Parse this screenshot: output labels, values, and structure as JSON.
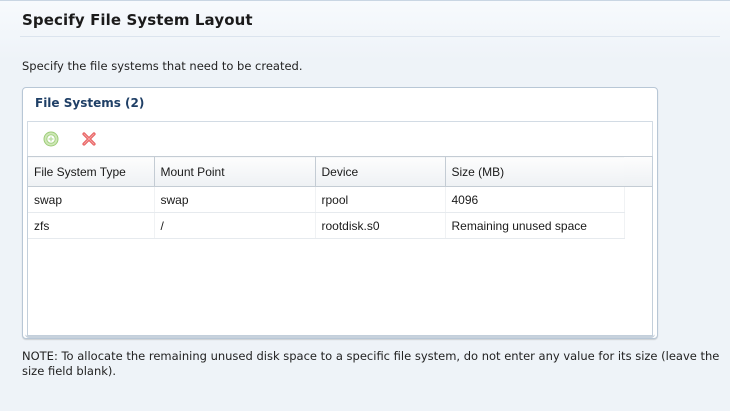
{
  "page": {
    "title": "Specify File System Layout",
    "description": "Specify the file systems that need to be created.",
    "note": "NOTE: To allocate the remaining unused disk space to a specific file system, do not enter any value for its size (leave the size field blank)."
  },
  "panel": {
    "header": "File Systems (2)"
  },
  "toolbar": {
    "add_icon": "add-circle-icon",
    "delete_icon": "delete-x-icon",
    "colors": {
      "add": "#8bc34a",
      "delete": "#e84a4a"
    }
  },
  "table": {
    "columns": [
      "File System Type",
      "Mount Point",
      "Device",
      "Size (MB)"
    ],
    "rows": [
      [
        "swap",
        "swap",
        "rpool",
        "4096"
      ],
      [
        "zfs",
        "/",
        "rootdisk.s0",
        "Remaining unused space"
      ]
    ]
  }
}
